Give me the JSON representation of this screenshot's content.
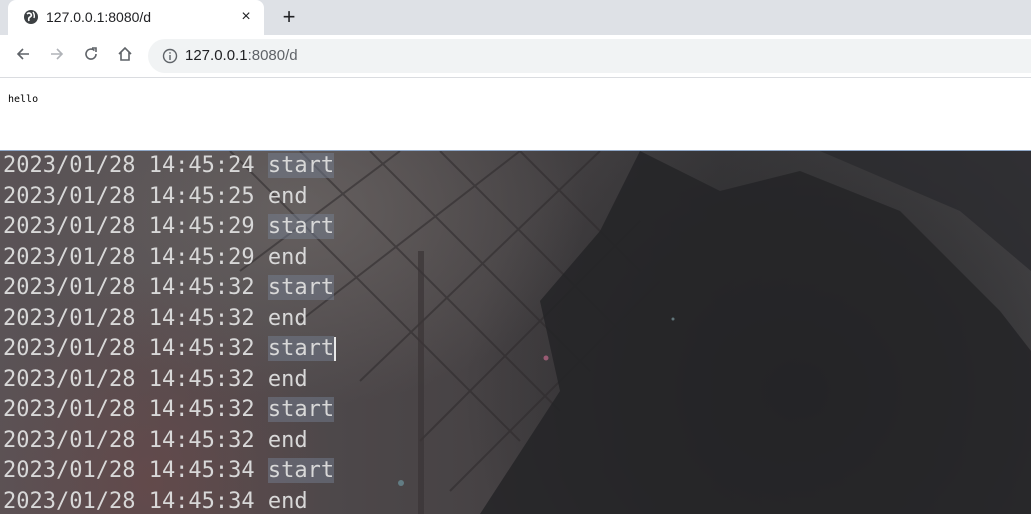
{
  "browser": {
    "tab": {
      "title": "127.0.0.1:8080/d",
      "close_symbol": "×",
      "icon": "globe-icon"
    },
    "new_tab_symbol": "+",
    "toolbar": {
      "back_icon": "arrow-left-icon",
      "forward_icon": "arrow-right-icon",
      "reload_icon": "reload-icon",
      "home_icon": "home-icon",
      "info_icon": "info-icon"
    },
    "address": {
      "host": "127.0.0.1",
      "rest": ":8080/d"
    }
  },
  "page": {
    "text": "hello"
  },
  "terminal": {
    "lines": [
      {
        "timestamp": "2023/01/28 14:45:24",
        "message": "start"
      },
      {
        "timestamp": "2023/01/28 14:45:25",
        "message": "end"
      },
      {
        "timestamp": "2023/01/28 14:45:29",
        "message": "start"
      },
      {
        "timestamp": "2023/01/28 14:45:29",
        "message": "end"
      },
      {
        "timestamp": "2023/01/28 14:45:32",
        "message": "start"
      },
      {
        "timestamp": "2023/01/28 14:45:32",
        "message": "end"
      },
      {
        "timestamp": "2023/01/28 14:45:32",
        "message": "start"
      },
      {
        "timestamp": "2023/01/28 14:45:32",
        "message": "end"
      },
      {
        "timestamp": "2023/01/28 14:45:32",
        "message": "start"
      },
      {
        "timestamp": "2023/01/28 14:45:32",
        "message": "end"
      },
      {
        "timestamp": "2023/01/28 14:45:34",
        "message": "start"
      },
      {
        "timestamp": "2023/01/28 14:45:34",
        "message": "end"
      }
    ]
  }
}
